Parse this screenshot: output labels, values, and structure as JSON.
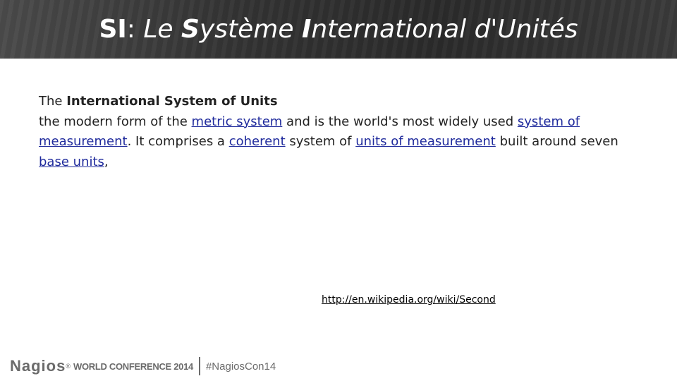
{
  "slide": {
    "title": {
      "si": "SI",
      "colon": ": ",
      "le": "Le ",
      "s": "S",
      "ysteme": "ystème ",
      "I": "I",
      "nternational": "nternational d'Unités"
    },
    "heading": {
      "prefix": "The ",
      "bold": "International System of Units"
    },
    "body": {
      "t1": "the modern form of the ",
      "link_metric": "metric system",
      "t2": " and is the world's most widely used ",
      "link_system": "system of measurement",
      "t3": ". It comprises a ",
      "link_coherent": "coherent",
      "t4": " system of ",
      "link_units": "units of measurement",
      "t5": " built around seven ",
      "link_base": "base units",
      "t6": ","
    },
    "source_url": "http://en.wikipedia.org/wiki/Second"
  },
  "footer": {
    "logo": "Nagios",
    "registered": "®",
    "conference": "WORLD CONFERENCE 2014",
    "hashtag": "#NagiosCon14"
  }
}
